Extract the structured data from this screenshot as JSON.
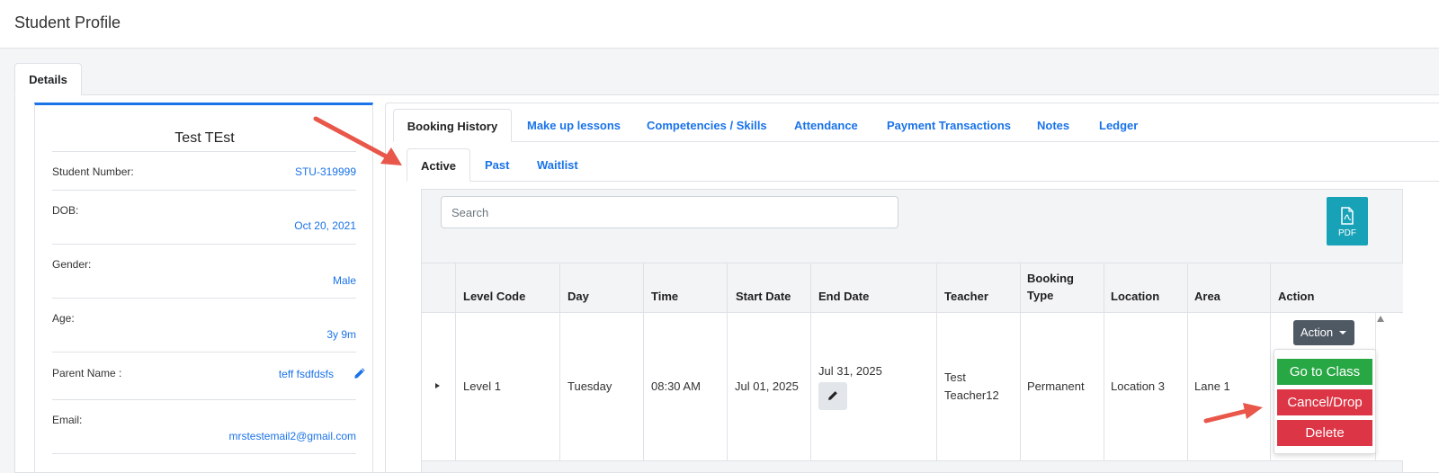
{
  "page": {
    "title": "Student Profile"
  },
  "profile_tabs": {
    "details": "Details"
  },
  "profile": {
    "name": "Test TEst",
    "fields": [
      {
        "label": "Student Number:",
        "value": "STU-319999"
      },
      {
        "label": "DOB:",
        "value": "Oct 20, 2021"
      },
      {
        "label": "Gender:",
        "value": "Male"
      },
      {
        "label": "Age:",
        "value": "3y 9m"
      },
      {
        "label": "Parent Name :",
        "value": "teff fsdfdsfs"
      },
      {
        "label": "Email:",
        "value": "mrstestemail2@gmail.com"
      }
    ]
  },
  "main_tabs": [
    "Booking History",
    "Make up lessons",
    "Competencies / Skills",
    "Attendance",
    "Payment Transactions",
    "Notes",
    "Ledger"
  ],
  "sub_tabs": [
    "Active",
    "Past",
    "Waitlist"
  ],
  "search": {
    "placeholder": "Search"
  },
  "pdf_button": {
    "label": "PDF"
  },
  "table": {
    "headers": [
      "Level Code",
      "Day",
      "Time",
      "Start Date",
      "End Date",
      "Teacher",
      "Booking Type",
      "Location",
      "Area",
      "Action"
    ],
    "header_lines": {
      "booking_type_1": "Booking",
      "booking_type_2": "Type"
    },
    "row": {
      "level_code": "Level 1",
      "day": "Tuesday",
      "time": "08:30 AM",
      "start_date": "Jul 01, 2025",
      "end_date": "Jul 31, 2025",
      "teacher_1": "Test",
      "teacher_2": "Teacher12",
      "booking_type": "Permanent",
      "location": "Location 3",
      "area": "Lane 1"
    }
  },
  "action_menu": {
    "toggle": "Action",
    "items": [
      "Go to Class",
      "Cancel/Drop",
      "Delete"
    ]
  },
  "colors": {
    "link": "#1a73e8",
    "primary_border": "#1a73e8",
    "pdf": "#17a2b8",
    "success": "#28a745",
    "danger": "#dc3545",
    "dark": "#4f5963",
    "annotation_arrow": "#e8574a"
  }
}
